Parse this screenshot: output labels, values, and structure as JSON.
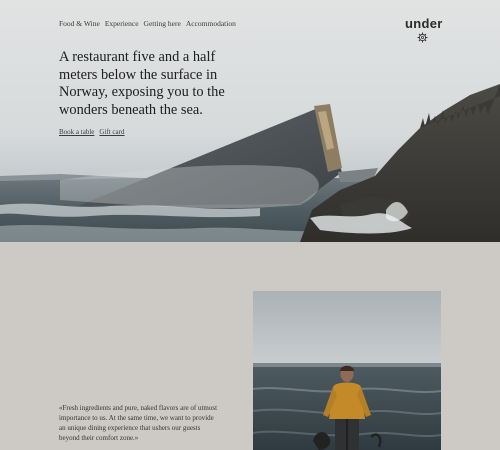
{
  "nav": {
    "items": [
      "Food & Wine",
      "Experience",
      "Getting here",
      "Accommodation"
    ]
  },
  "brand": {
    "logo_text": "under",
    "logo_mark": "gear-icon"
  },
  "hero": {
    "headline": "A restaurant five and a half meters below the surface in Norway, exposing you to the wonders beneath the sea.",
    "links": [
      "Book a table",
      "Gift card"
    ]
  },
  "story": {
    "quote": "«Fresh ingredients and pure, naked flavors are of utmost importance to us. At the same time, we want to provide an unique dining experience that ushers our guests beyond their comfort zone.»"
  },
  "colors": {
    "page_background": "#cdcac5",
    "text": "#202020"
  }
}
